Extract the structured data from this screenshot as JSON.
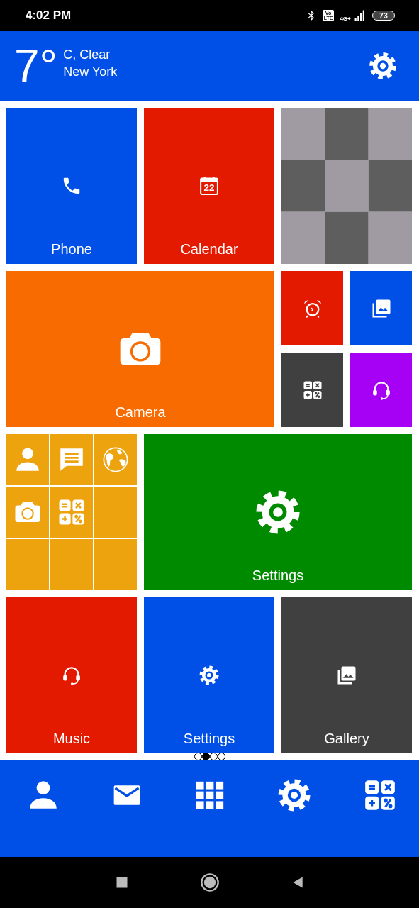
{
  "status_bar": {
    "time": "4:02 PM",
    "volte": [
      "Vo",
      "LTE"
    ],
    "network": "4G+",
    "battery": "73"
  },
  "weather": {
    "temperature": "7°",
    "condition": "C, Clear",
    "city": "New York"
  },
  "tiles": [
    {
      "kind": "app",
      "label": "Phone",
      "color": "#0050e8"
    },
    {
      "kind": "app",
      "label": "Calendar",
      "color": "#e31a00",
      "calendar_day": "22"
    },
    {
      "kind": "picture"
    },
    {
      "kind": "app",
      "label": "Camera",
      "color": "#f86b00",
      "wide": true
    },
    {
      "kind": "group",
      "items": [
        {
          "color": "#e31a00"
        },
        {
          "color": "#0050e8"
        },
        {
          "color": "#404040"
        },
        {
          "color": "#a600f5"
        }
      ]
    },
    {
      "kind": "folder",
      "color": "#eda30e"
    },
    {
      "kind": "app",
      "label": "Settings",
      "color": "#008a00",
      "wide": true
    },
    {
      "kind": "app",
      "label": "Music",
      "color": "#e31a00"
    },
    {
      "kind": "app",
      "label": "Settings",
      "color": "#0050e8"
    },
    {
      "kind": "app",
      "label": "Gallery",
      "color": "#404040"
    }
  ],
  "pages": [
    {
      "selected": false
    },
    {
      "selected": true
    },
    {
      "selected": false
    },
    {
      "selected": false
    }
  ]
}
